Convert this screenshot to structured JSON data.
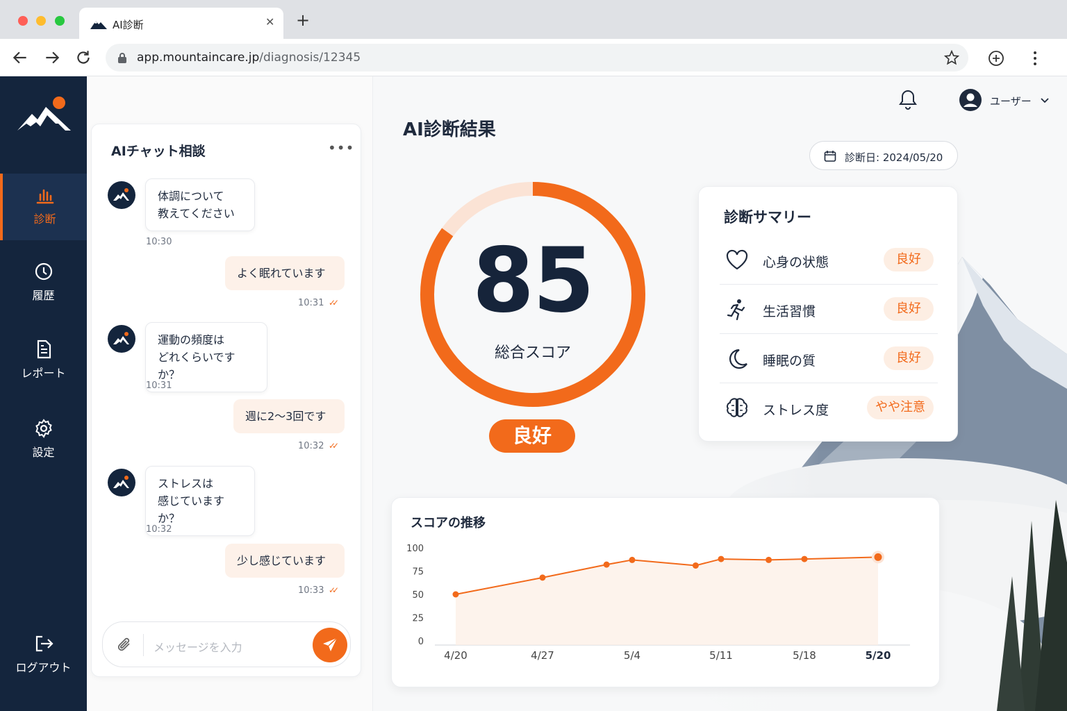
{
  "browser": {
    "tab_title": "AI診断",
    "url_host": "app.mountaincare.jp",
    "url_path": "/diagnosis/12345"
  },
  "sidebar": {
    "items": [
      {
        "label": "診断",
        "icon": "chart-icon",
        "active": true
      },
      {
        "label": "履歴",
        "icon": "clock-icon"
      },
      {
        "label": "レポート",
        "icon": "document-icon"
      },
      {
        "label": "設定",
        "icon": "gear-icon"
      }
    ],
    "logout_label": "ログアウト"
  },
  "chat": {
    "title": "AIチャット相談",
    "messages": [
      {
        "from": "bot",
        "lines": [
          "体調について",
          "教えてください"
        ],
        "time": "10:30"
      },
      {
        "from": "user",
        "lines": [
          "よく眠れています"
        ],
        "time": "10:31"
      },
      {
        "from": "bot",
        "lines": [
          "運動の頻度は",
          "どれくらいですか？"
        ],
        "time": "10:31"
      },
      {
        "from": "user",
        "lines": [
          "週に2〜3回です"
        ],
        "time": "10:32"
      },
      {
        "from": "bot",
        "lines": [
          "ストレスは",
          "感じていますか？"
        ],
        "time": "10:32"
      },
      {
        "from": "user",
        "lines": [
          "少し感じています"
        ],
        "time": "10:33"
      }
    ],
    "input_placeholder": "メッセージを入力"
  },
  "header": {
    "user_name": "ユーザー"
  },
  "result": {
    "title": "AI診断結果",
    "date_label": "診断日: 2024/05/20",
    "score": "85",
    "score_label": "総合スコア",
    "score_fraction": 0.85,
    "status": "良好"
  },
  "summary": {
    "title": "診断サマリー",
    "rows": [
      {
        "label": "心身の状態",
        "icon": "heart-icon",
        "status": "良好"
      },
      {
        "label": "生活習慣",
        "icon": "running-icon",
        "status": "良好"
      },
      {
        "label": "睡眠の質",
        "icon": "moon-icon",
        "status": "良好"
      },
      {
        "label": "ストレス度",
        "icon": "brain-icon",
        "status": "やや注意"
      }
    ]
  },
  "colors": {
    "accent": "#f26a1b",
    "sidebar": "#14253d"
  },
  "chart_data": {
    "type": "line",
    "title": "スコアの推移",
    "x_ticks": [
      "4/20",
      "4/27",
      "5/4",
      "5/11",
      "5/18",
      "5/20"
    ],
    "y_ticks": [
      "100",
      "75",
      "50",
      "25",
      "0"
    ],
    "ylim": [
      0,
      100
    ],
    "grid": false,
    "points": [
      {
        "x": "4/20",
        "y": 50
      },
      {
        "x": "4/27",
        "y": 68
      },
      {
        "x": "5/2",
        "y": 82
      },
      {
        "x": "5/4",
        "y": 87
      },
      {
        "x": "5/9",
        "y": 81
      },
      {
        "x": "5/11",
        "y": 88
      },
      {
        "x": "5/15",
        "y": 87
      },
      {
        "x": "5/18",
        "y": 88
      },
      {
        "x": "5/20",
        "y": 90
      }
    ]
  }
}
